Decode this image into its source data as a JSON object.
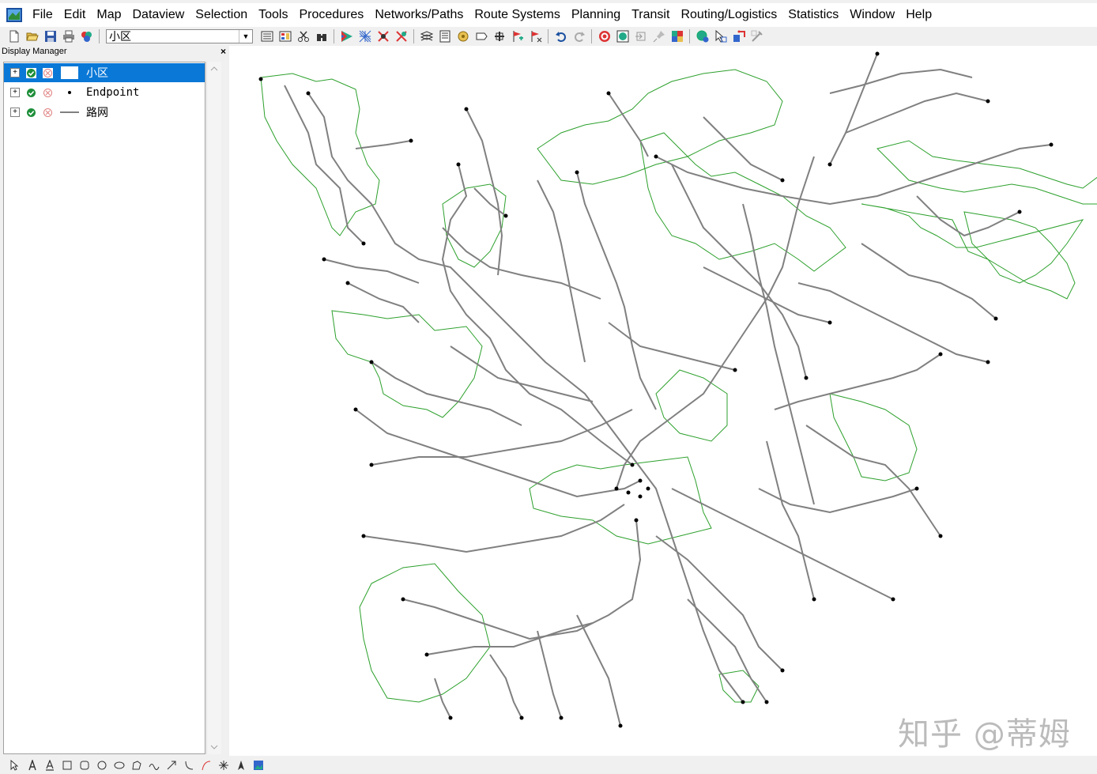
{
  "menu": [
    "File",
    "Edit",
    "Map",
    "Dataview",
    "Selection",
    "Tools",
    "Procedures",
    "Networks/Paths",
    "Route Systems",
    "Planning",
    "Transit",
    "Routing/Logistics",
    "Statistics",
    "Window",
    "Help"
  ],
  "toolbar": {
    "layer_select_value": "小区",
    "icons": [
      "new-file-icon",
      "open-folder-icon",
      "save-icon",
      "print-icon",
      "map-layers-icon"
    ],
    "icons2": [
      "layer-list-icon",
      "legend-icon",
      "scissors-icon",
      "binoculars-icon",
      "sep",
      "theme-icon",
      "pattern-icon",
      "fill-icon",
      "selection-icon",
      "sep",
      "layers-icon",
      "dataview-icon",
      "label-icon",
      "tag-icon",
      "km-icon",
      "flag-add-icon",
      "flag-remove-icon",
      "sep",
      "undo-icon",
      "redo-icon",
      "sep",
      "target-icon",
      "zoom-globe-icon",
      "import-icon",
      "pin-icon",
      "grid-icon",
      "sep",
      "globe-icon",
      "cursor-icon",
      "route-icon",
      "tool-icon"
    ]
  },
  "display_manager": {
    "title": "Display Manager",
    "close": "×",
    "layers": [
      {
        "name": "小区",
        "symbol": "area",
        "selected": true
      },
      {
        "name": "Endpoint",
        "symbol": "point",
        "selected": false
      },
      {
        "name": "路网",
        "symbol": "line",
        "selected": false
      }
    ]
  },
  "map": {
    "line_color": "#808080",
    "area_color": "#2ca02c",
    "point_color": "#000000"
  },
  "statusbar_tools": [
    "pointer-icon",
    "text-icon",
    "underline-text-icon",
    "rectangle-icon",
    "rounded-rect-icon",
    "circle-icon",
    "ellipse-icon",
    "freehand-shape-icon",
    "curve-icon",
    "arrow-icon",
    "arc-icon",
    "bezier-icon",
    "star-icon",
    "north-arrow-icon",
    "image-icon"
  ],
  "watermark": "知乎 @蒂姆"
}
